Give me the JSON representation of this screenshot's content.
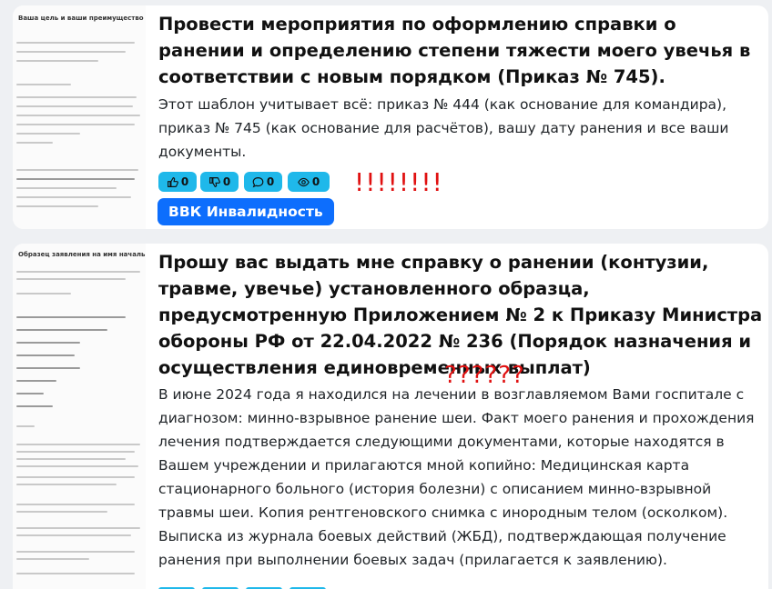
{
  "cards": [
    {
      "thumb_title": "Ваша цель и ваши преимущество",
      "title": "Провести мероприятия по оформлению справки о ранении и определению степени тяжести моего увечья в соответствии с новым порядком (Приказ № 745).",
      "description": "Этот шаблон учитывает всё: приказ № 444 (как основание для командира), приказ № 745 (как основание для расчётов), вашу дату ранения и все ваши документы.",
      "stats": {
        "likes": "0",
        "dislikes": "0",
        "comments": "0",
        "views": "0"
      },
      "tag": "ВВК Инвалидность",
      "annotation": "!!!!!!!!"
    },
    {
      "thumb_title": "Образец заявления на имя начальника госпиталя",
      "title": "Прошу вас выдать мне справку о ранении (контузии, травме, увечье) установленного образца, предусмотренную Приложением № 2 к Приказу Министра обороны РФ от 22.04.2022 № 236 (Порядок назначения и осуществления единовременных выплат)",
      "description": "В июне 2024 года я находился на лечении в возглавляемом Вами госпитале с диагнозом: минно-взрывное ранение шеи. Факт моего ранения и прохождения лечения подтверждается следующими документами, которые находятся в Вашем учреждении и прилагаются мной копийно: Медицинская карта стационарного больного (история болезни) с описанием минно-взрывной травмы шеи. Копия рентгеновского снимка с инородным телом (осколком). Выписка из журнала боевых действий (ЖБД), подтверждающая получение ранения при выполнении боевых задач (прилагается к заявлению).",
      "annotation": "??????"
    }
  ],
  "colors": {
    "stat_badge": "#1fb8ea",
    "tag_button": "#0d6efd",
    "annotation": "#e01010"
  }
}
